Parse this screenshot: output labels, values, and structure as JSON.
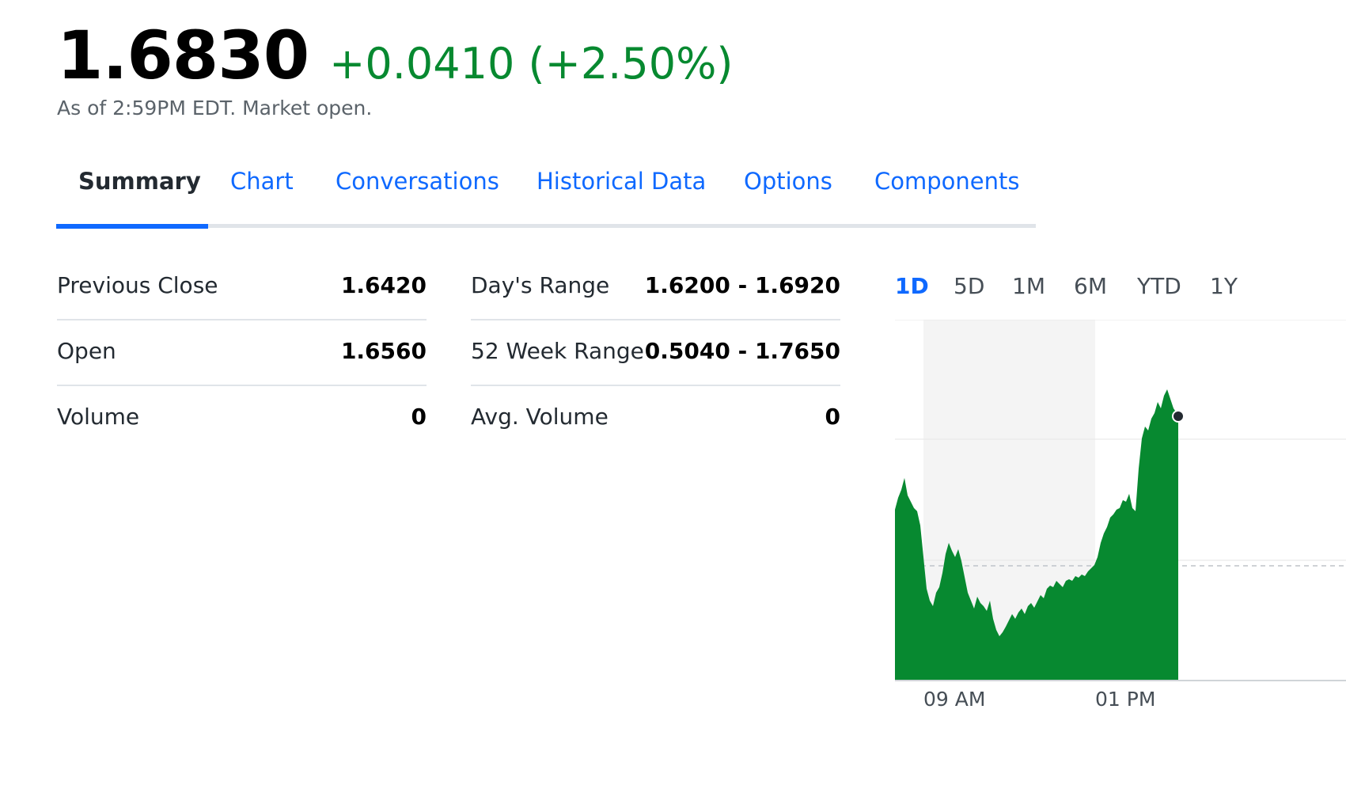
{
  "quote": {
    "price": "1.6830",
    "change": "+0.0410 (+2.50%)",
    "as_of": "As of 2:59PM EDT. Market open.",
    "change_color": "#078930"
  },
  "tabs": [
    {
      "label": "Summary",
      "active": true
    },
    {
      "label": "Chart"
    },
    {
      "label": "Conversations"
    },
    {
      "label": "Historical Data"
    },
    {
      "label": "Options"
    },
    {
      "label": "Components"
    }
  ],
  "stats_left": [
    {
      "label": "Previous Close",
      "value": "1.6420"
    },
    {
      "label": "Open",
      "value": "1.6560"
    },
    {
      "label": "Volume",
      "value": "0"
    }
  ],
  "stats_right": [
    {
      "label": "Day's Range",
      "value": "1.6200 - 1.6920"
    },
    {
      "label": "52 Week Range",
      "value": "0.5040 - 1.7650"
    },
    {
      "label": "Avg. Volume",
      "value": "0"
    }
  ],
  "chart": {
    "ranges": [
      "1D",
      "5D",
      "1M",
      "6M",
      "YTD",
      "1Y"
    ],
    "active_range": "1D",
    "x_ticks": [
      "09 AM",
      "01 PM"
    ],
    "fill_color": "#078930",
    "previous_close_line": true
  },
  "colors": {
    "accent": "#0f69ff",
    "positive": "#078930"
  }
}
